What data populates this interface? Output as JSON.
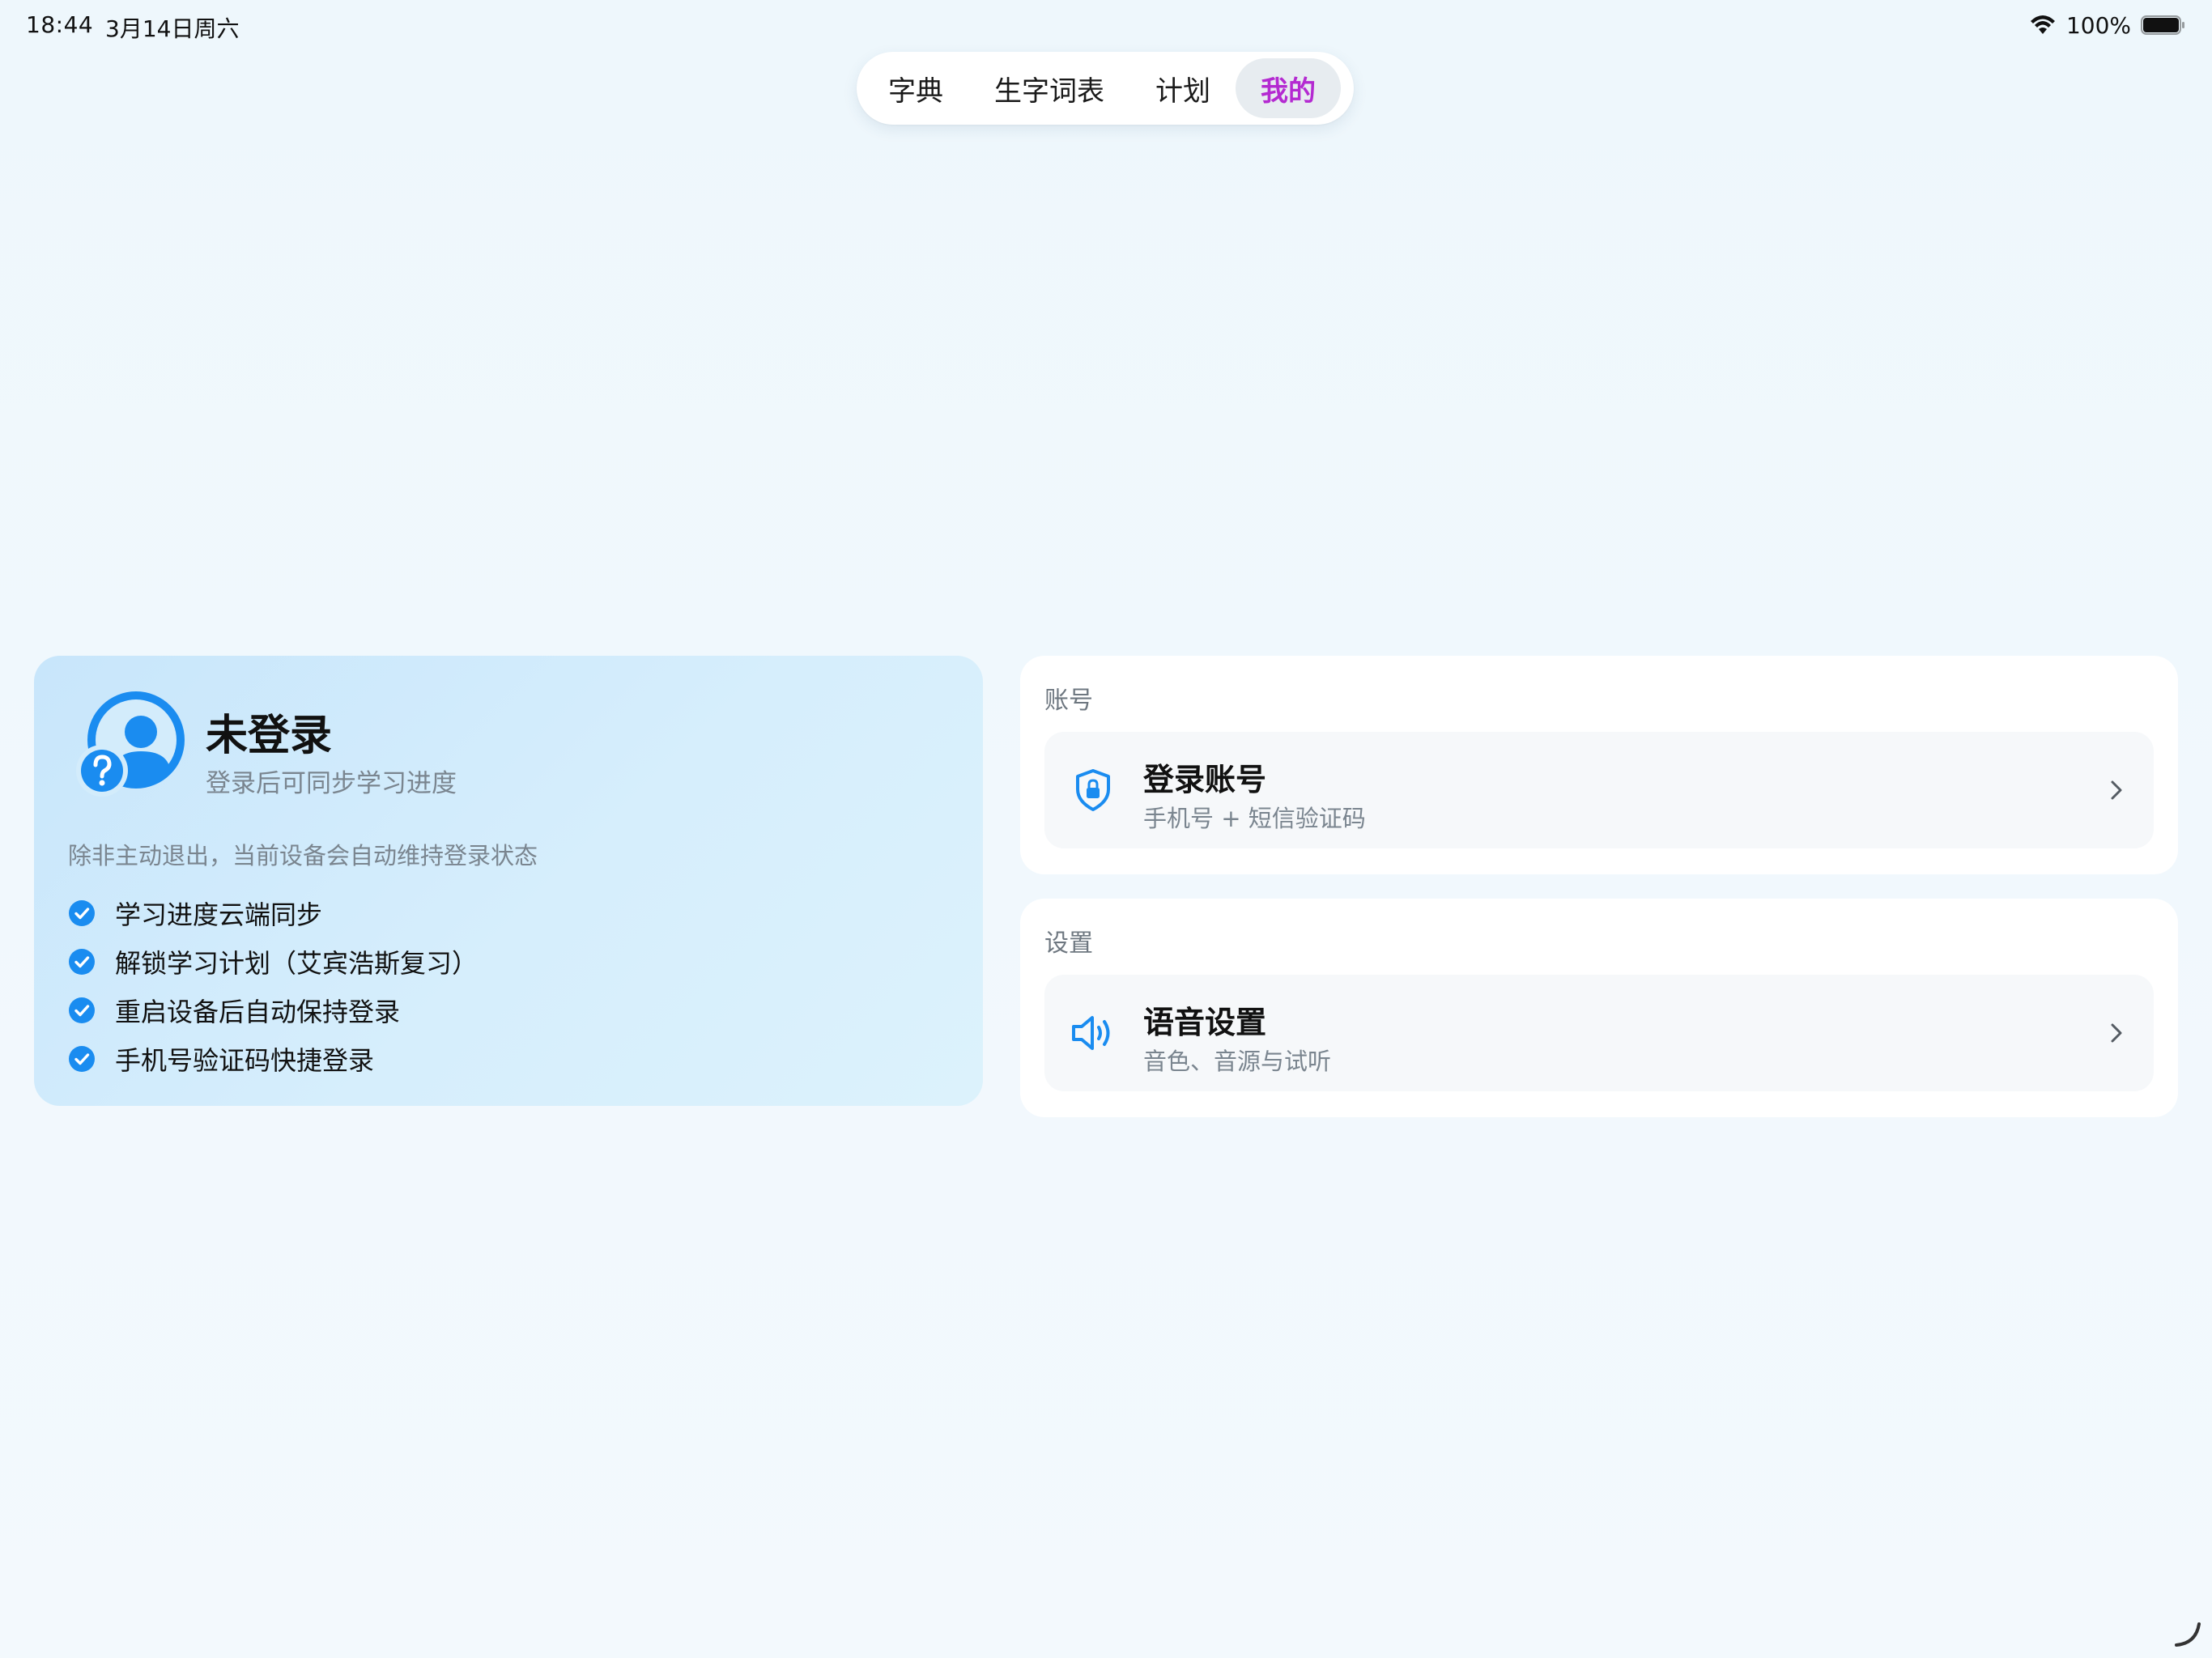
{
  "status_bar": {
    "time": "18:44",
    "date": "3月14日周六",
    "battery": "100%"
  },
  "tabs": [
    {
      "label": "字典",
      "active": false
    },
    {
      "label": "生字词表",
      "active": false
    },
    {
      "label": "计划",
      "active": false
    },
    {
      "label": "我的",
      "active": true
    }
  ],
  "login_card": {
    "title": "未登录",
    "subtitle": "登录后可同步学习进度",
    "note": "除非主动退出，当前设备会自动维持登录状态",
    "benefits": [
      "学习进度云端同步",
      "解锁学习计划（艾宾浩斯复习）",
      "重启设备后自动保持登录",
      "手机号验证码快捷登录"
    ]
  },
  "account_section": {
    "title": "账号",
    "item": {
      "title": "登录账号",
      "subtitle": "手机号 + 短信验证码",
      "icon": "shield-lock-icon"
    }
  },
  "settings_section": {
    "title": "设置",
    "item": {
      "title": "语音设置",
      "subtitle": "音色、音源与试听",
      "icon": "speaker-icon"
    }
  },
  "colors": {
    "accent_blue": "#1a8cf0",
    "active_tab_text": "#b42ad1",
    "secondary_text": "#7a858f"
  }
}
